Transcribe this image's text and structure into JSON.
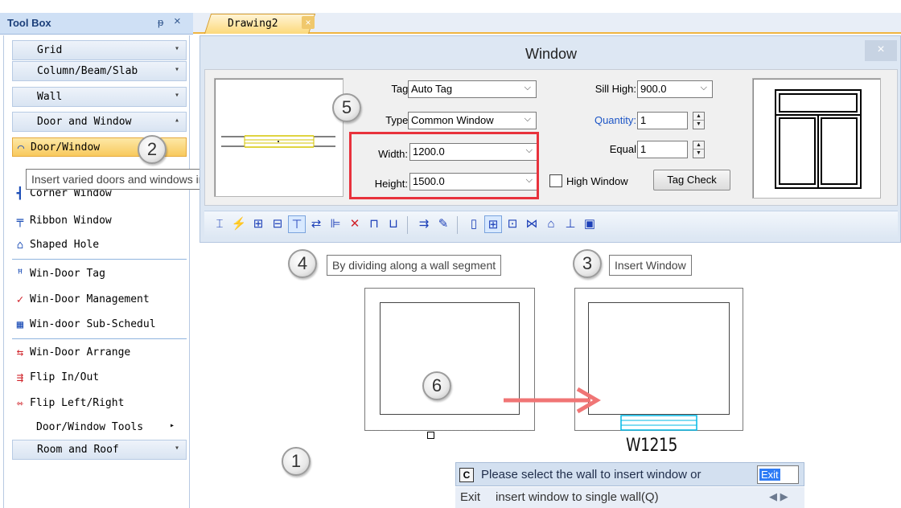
{
  "toolbox": {
    "title": "Tool Box",
    "categories": [
      {
        "label": "Grid",
        "arrow": "▾"
      },
      {
        "label": "Column/Beam/Slab",
        "arrow": "▾"
      },
      {
        "label": "Wall",
        "arrow": "▾"
      },
      {
        "label": "Door and Window",
        "arrow": "▴"
      }
    ],
    "items": [
      {
        "label": "Door/Window",
        "icon": "door-window-icon",
        "selected": true
      },
      {
        "label": "Corner Window",
        "icon": "corner-window-icon"
      },
      {
        "label": "Ribbon Window",
        "icon": "ribbon-window-icon"
      },
      {
        "label": "Shaped Hole",
        "icon": "shaped-hole-icon"
      },
      {
        "label": "Win-Door Tag",
        "icon": "tag-icon"
      },
      {
        "label": "Win-Door Management",
        "icon": "management-icon"
      },
      {
        "label": "Win-door Sub-Schedul",
        "icon": "schedule-icon"
      },
      {
        "label": "Win-Door Arrange",
        "icon": "arrange-icon"
      },
      {
        "label": "Flip In/Out",
        "icon": "flip-inout-icon"
      },
      {
        "label": "Flip Left/Right",
        "icon": "flip-leftright-icon"
      },
      {
        "label": "Door/Window Tools",
        "icon": "",
        "arrow": "▸"
      }
    ],
    "bottom_category": {
      "label": "Room and Roof",
      "arrow": "▾"
    },
    "tooltip": "Insert varied doors and windows in walls"
  },
  "tab": {
    "label": "Drawing2",
    "close": "×"
  },
  "dialog": {
    "title": "Window",
    "close": "×",
    "tag": {
      "label": "Tag:",
      "value": "Auto Tag"
    },
    "type": {
      "label": "Type:",
      "value": "Common Window"
    },
    "width": {
      "label": "Width:",
      "value": "1200.0"
    },
    "height": {
      "label": "Height:",
      "value": "1500.0"
    },
    "sill": {
      "label": "Sill High:",
      "value": "900.0"
    },
    "quantity": {
      "label": "Quantity:",
      "value": "1"
    },
    "equal": {
      "label": "Equal",
      "value": "1"
    },
    "high_window": {
      "label": "High Window",
      "checked": false
    },
    "tag_check": "Tag Check",
    "link_color": "#1c55c6"
  },
  "tooltips": {
    "dividing": "By dividing along a wall segment",
    "insert_window": "Insert Window"
  },
  "callouts": [
    "1",
    "2",
    "3",
    "4",
    "5",
    "6"
  ],
  "drawing": {
    "window_tag": "W1215"
  },
  "command": {
    "icon": "C",
    "prompt": "Please select the wall to insert window or",
    "option": "Exit",
    "hint_label": "Exit",
    "hint_text": "insert window to single wall(Q)",
    "arrows": "◀  ▶"
  }
}
